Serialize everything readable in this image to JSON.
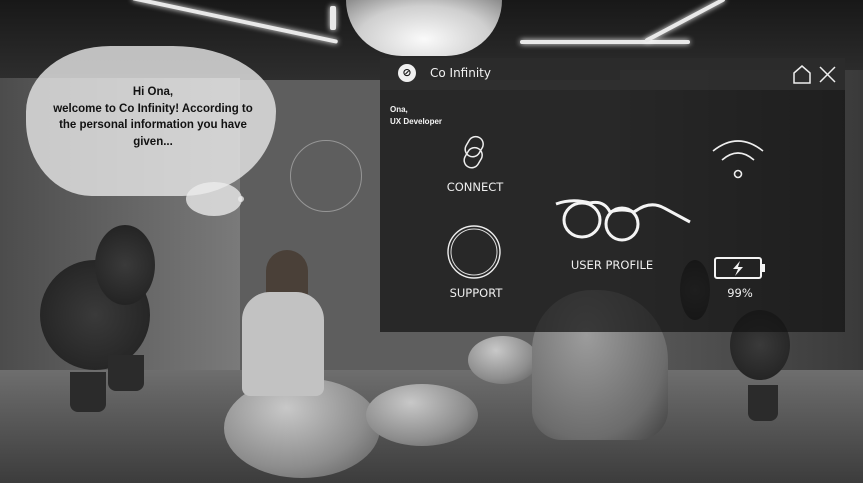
{
  "bubble": {
    "greeting": "Hi Ona,",
    "line2": "welcome to Co Infinity! According to",
    "line3": "the personal information you have",
    "line4": "given..."
  },
  "panel": {
    "title": "Co Infinity",
    "logo_icon": "logo-icon",
    "home_icon": "home-icon",
    "close_icon": "close-icon",
    "user": {
      "name": "Ona,",
      "role": "UX Developer"
    },
    "tiles": [
      {
        "label": "CONNECT",
        "icon": "chain-link-icon"
      },
      {
        "label": "USER PROFILE",
        "icon": "glasses-icon"
      },
      {
        "label": "SUPPORT",
        "icon": "circle-ring-icon"
      },
      {
        "label": "",
        "icon": "wifi-icon"
      },
      {
        "label": "99%",
        "icon": "battery-charging-icon",
        "battery_level": 0.99
      }
    ]
  }
}
